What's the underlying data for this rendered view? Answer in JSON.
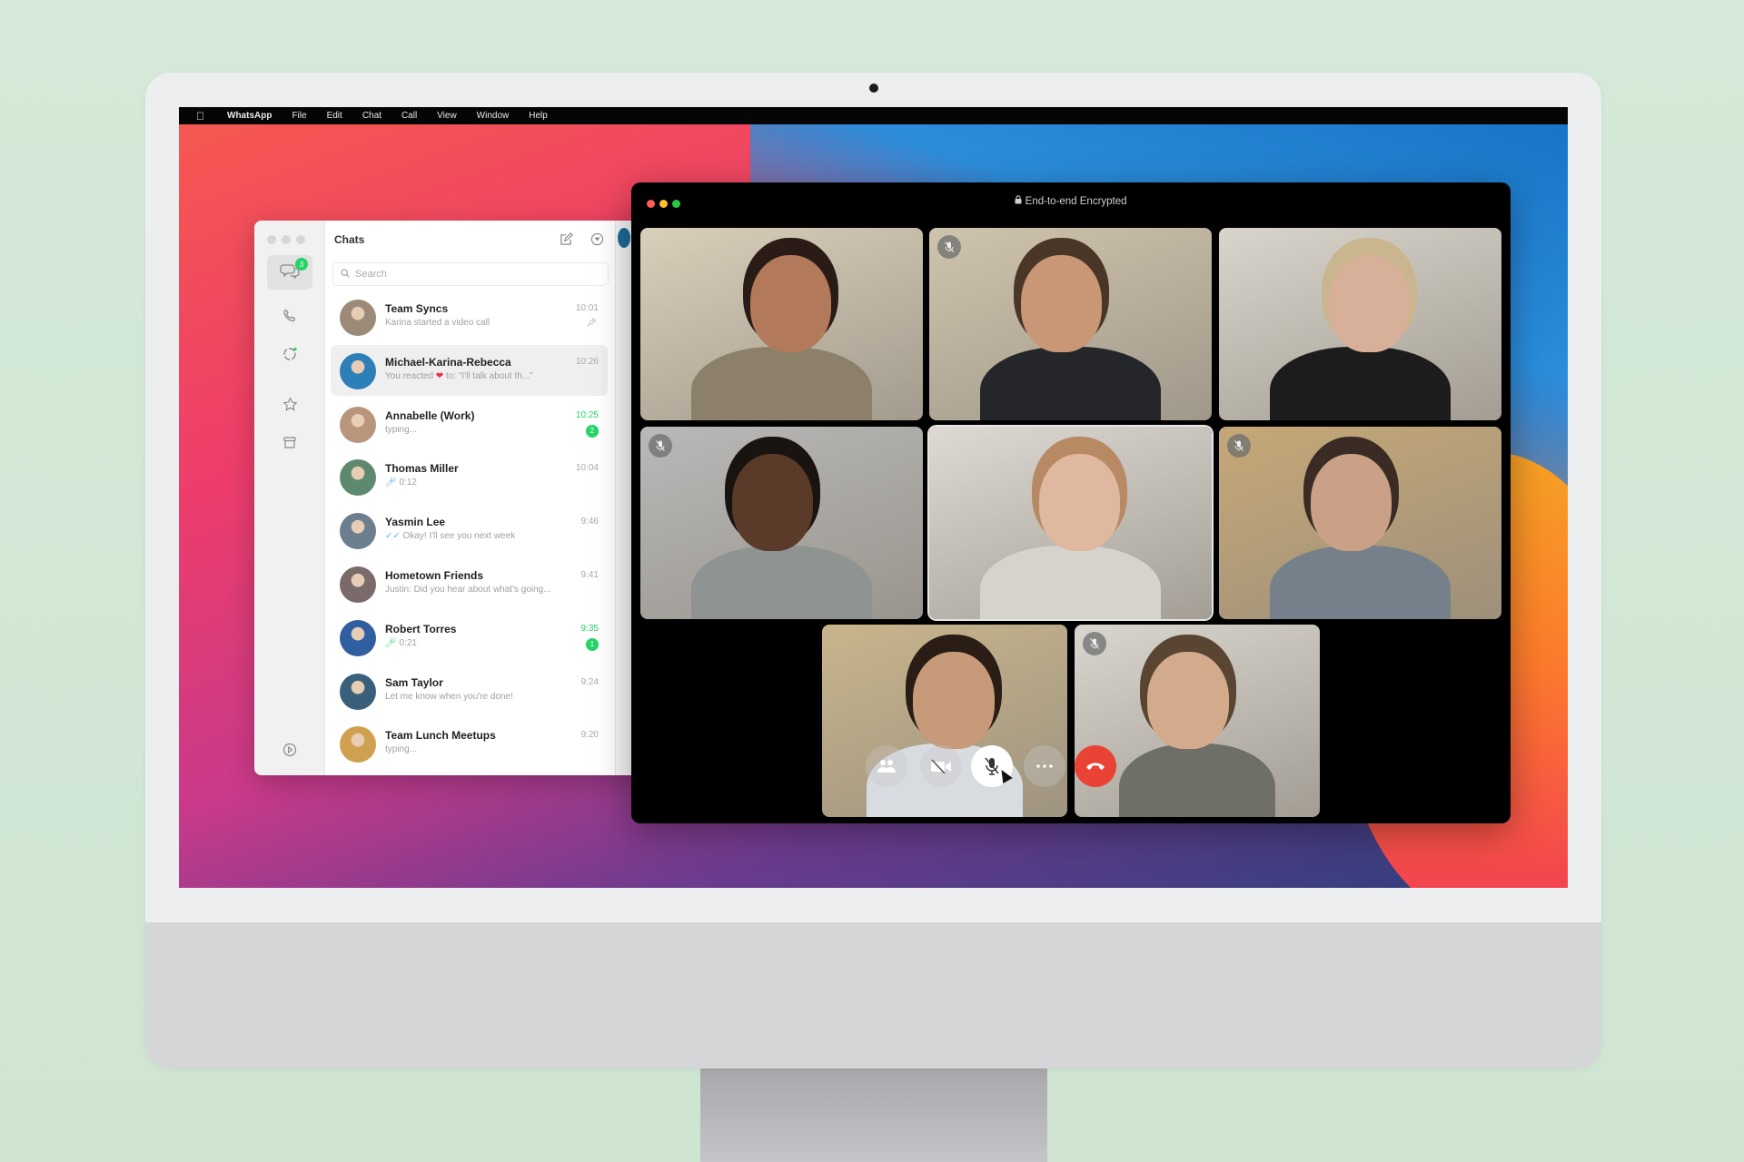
{
  "menubar": {
    "apple_icon": "apple-logo-icon",
    "items": [
      "WhatsApp",
      "File",
      "Edit",
      "Chat",
      "Call",
      "View",
      "Window",
      "Help"
    ]
  },
  "chat_window": {
    "title": "Chats",
    "search_placeholder": "Search",
    "rail": {
      "chats_badge": "3",
      "items": [
        "chats-icon",
        "calls-icon",
        "status-icon",
        "starred-icon",
        "archived-icon"
      ],
      "bottom_item": "settings-icon"
    },
    "chats": [
      {
        "name": "Team Syncs",
        "preview": "Karina started a video call",
        "time": "10:01",
        "pinned": true,
        "unread": null,
        "time_green": false,
        "avatar_color": "#9b8a77"
      },
      {
        "name": "Michael-Karina-Rebecca",
        "preview_prefix": "You reacted ",
        "preview_suffix": " to: \"I'll talk about th...\"",
        "reaction": "❤",
        "time": "10:26",
        "pinned": false,
        "unread": null,
        "time_green": false,
        "selected": true,
        "avatar_color": "#2d7fb8"
      },
      {
        "name": "Annabelle (Work)",
        "preview": "typing...",
        "time": "10:25",
        "pinned": false,
        "unread": "2",
        "time_green": true,
        "avatar_color": "#b9957b"
      },
      {
        "name": "Thomas Miller",
        "preview": "0:12",
        "voice_note": true,
        "time": "10:04",
        "pinned": false,
        "unread": null,
        "time_green": false,
        "avatar_color": "#5d8a6e"
      },
      {
        "name": "Yasmin Lee",
        "preview": "Okay! I'll see you next week",
        "read_ticks": true,
        "time": "9:46",
        "pinned": false,
        "unread": null,
        "time_green": false,
        "avatar_color": "#6d7f8f"
      },
      {
        "name": "Hometown Friends",
        "preview": "Justin: Did you hear about what's going...",
        "time": "9:41",
        "pinned": false,
        "unread": null,
        "time_green": false,
        "avatar_color": "#7a6a6a"
      },
      {
        "name": "Robert Torres",
        "preview": "0:21",
        "voice_note": true,
        "voice_note_green": true,
        "time": "9:35",
        "pinned": false,
        "unread": "1",
        "time_green": true,
        "avatar_color": "#2f5fa0"
      },
      {
        "name": "Sam Taylor",
        "preview": "Let me know when you're done!",
        "time": "9:24",
        "pinned": false,
        "unread": null,
        "time_green": false,
        "avatar_color": "#3a5f7a"
      },
      {
        "name": "Team Lunch Meetups",
        "preview": "typing...",
        "time": "9:20",
        "pinned": false,
        "unread": null,
        "time_green": false,
        "avatar_color": "#d0a050"
      }
    ]
  },
  "call_window": {
    "title": "End-to-end Encrypted",
    "lock_icon": "lock-icon",
    "participants": [
      {
        "muted": false,
        "speaking": false,
        "bg": "#d9cfba",
        "skin": "#b27a5a",
        "hair": "#2a1b16",
        "shirt": "#8c806a"
      },
      {
        "muted": true,
        "speaking": false,
        "bg": "#cfc4ad",
        "skin": "#c99676",
        "hair": "#4a3626",
        "shirt": "#242629"
      },
      {
        "muted": false,
        "speaking": false,
        "bg": "#d9d5cc",
        "skin": "#d8b09a",
        "hair": "#c9b58e",
        "shirt": "#1c1c1c"
      },
      {
        "muted": true,
        "speaking": false,
        "bg": "#b9b9b8",
        "skin": "#5a3a28",
        "hair": "#1a1411",
        "shirt": "#8f9391"
      },
      {
        "muted": false,
        "speaking": true,
        "bg": "#dddad4",
        "skin": "#e0b8a0",
        "hair": "#b78a64",
        "shirt": "#d6d2cc"
      },
      {
        "muted": true,
        "speaking": false,
        "bg": "#c6a877",
        "skin": "#caa086",
        "hair": "#3a2c24",
        "shirt": "#75808a"
      },
      {
        "muted": false,
        "speaking": false,
        "bg": "#c9b58c",
        "skin": "#c79a7a",
        "hair": "#2a1d16",
        "shirt": "#d8dbe0"
      },
      {
        "muted": true,
        "speaking": false,
        "bg": "#d9d6cf",
        "skin": "#d4aa8c",
        "hair": "#5a4533",
        "shirt": "#6e7068"
      }
    ],
    "controls": [
      {
        "name": "participants-button",
        "icon": "people-icon",
        "glyph": "👥"
      },
      {
        "name": "video-off-button",
        "icon": "video-off-icon",
        "glyph": "⊘"
      },
      {
        "name": "mute-button",
        "icon": "mic-off-icon",
        "glyph": "🎙"
      },
      {
        "name": "more-button",
        "icon": "more-icon",
        "glyph": "···"
      },
      {
        "name": "end-call-button",
        "icon": "end-call-icon",
        "glyph": "☎"
      }
    ],
    "muted_glyph": "🎙"
  },
  "colors": {
    "whatsapp_green": "#25d366",
    "end_call_red": "#ea4335",
    "traffic_red": "#fe5f57",
    "traffic_yellow": "#febc2e",
    "traffic_green": "#28c840"
  }
}
